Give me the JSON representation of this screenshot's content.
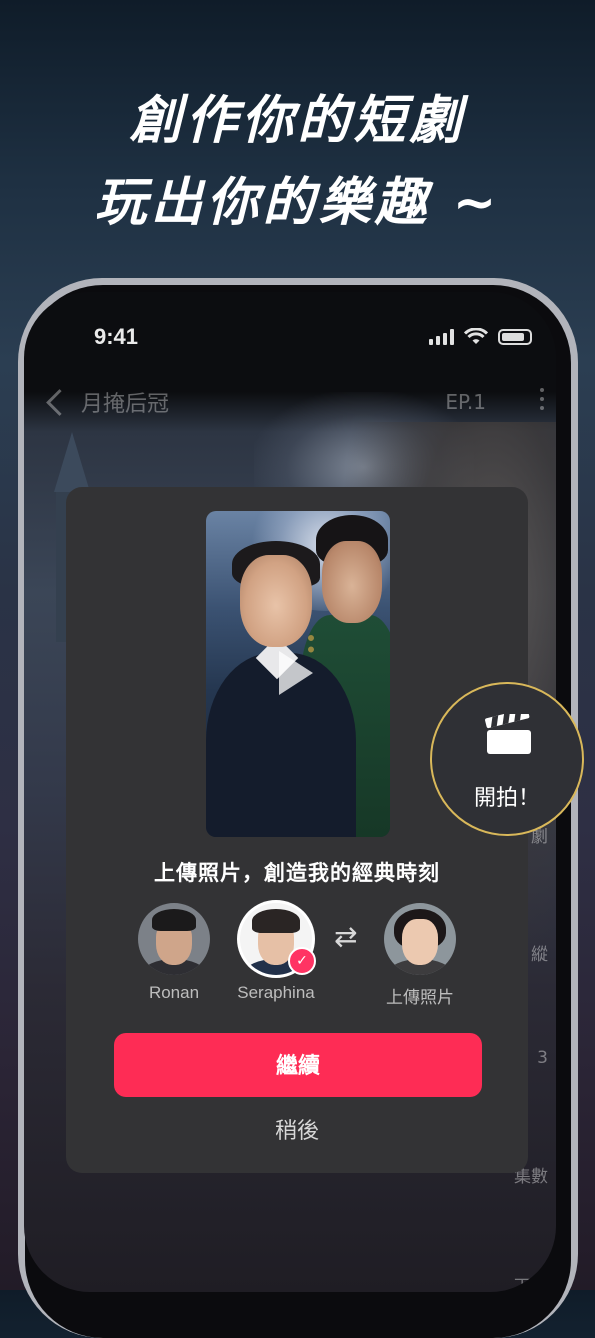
{
  "headline": {
    "line1": "創作你的短劇",
    "line2": "玩出你的樂趣 ~"
  },
  "status_bar": {
    "time": "9:41"
  },
  "player": {
    "show_title": "月掩后冠",
    "episode": "EP.1",
    "side_labels": [
      "劇",
      "縱",
      "3",
      "集數",
      "下載"
    ]
  },
  "dialog": {
    "title": "上傳照片，創造我的經典時刻",
    "avatars": [
      {
        "label": "Ronan",
        "selected": false
      },
      {
        "label": "Seraphina",
        "selected": true
      },
      {
        "label": "上傳照片",
        "selected": false
      }
    ],
    "continue_label": "繼續",
    "later_label": "稍後"
  },
  "shoot_badge": {
    "label": "開拍！",
    "icon": "clapperboard-icon"
  },
  "colors": {
    "accent": "#fe2c55",
    "badge_border": "#d9b85a",
    "dialog_bg": "#333335"
  }
}
